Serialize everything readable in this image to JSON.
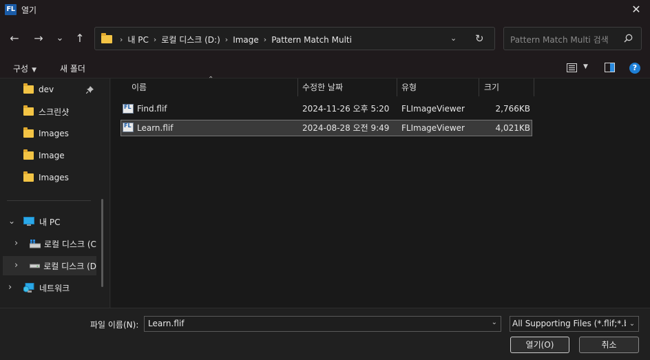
{
  "window": {
    "app_icon_text": "FL",
    "title": "열기",
    "close_glyph": "✕"
  },
  "nav": {
    "back": "←",
    "forward": "→",
    "recent": "⌄",
    "up": "↑",
    "breadcrumb": [
      "내 PC",
      "로컬 디스크 (D:)",
      "Image",
      "Pattern Match Multi"
    ],
    "first_sep": "›",
    "separators": [
      "›",
      "›",
      "›"
    ],
    "dropdown_glyph": "⌄",
    "refresh_glyph": "↻",
    "search_placeholder": "Pattern Match Multi 검색"
  },
  "toolbar": {
    "organize_label": "구성",
    "organize_caret": "▼",
    "new_folder_label": "새 폴더",
    "view_caret": "▼",
    "help_glyph": "?"
  },
  "sidebar": {
    "quick_access": [
      {
        "label": "dev",
        "pinned": true
      },
      {
        "label": "스크린샷"
      },
      {
        "label": "Images"
      },
      {
        "label": "Image"
      },
      {
        "label": "Images"
      }
    ],
    "this_pc": {
      "label": "내 PC",
      "chevron": "⌄"
    },
    "drives": [
      {
        "label": "로컬 디스크 (C",
        "chevron": "›"
      },
      {
        "label": "로컬 디스크 (D",
        "chevron": "›",
        "selected": true
      }
    ],
    "network": {
      "label": "네트워크",
      "chevron": "›"
    }
  },
  "filelist": {
    "columns": [
      "이름",
      "수정한 날짜",
      "유형",
      "크기"
    ],
    "sort_glyph": "⌃",
    "rows": [
      {
        "name": "Find.flif",
        "modified": "2024-11-26 오후 5:20",
        "type": "FLImageViewer",
        "size": "2,766KB"
      },
      {
        "name": "Learn.flif",
        "modified": "2024-08-28 오전 9:49",
        "type": "FLImageViewer",
        "size": "4,021KB",
        "selected": true
      }
    ]
  },
  "footer": {
    "filename_label": "파일 이름(N):",
    "filename_value": "Learn.flif",
    "filename_caret": "⌄",
    "filetype_value": "All Supporting Files (*.flif;*.bm",
    "filetype_caret": "⌄",
    "open_label": "열기(O)",
    "cancel_label": "취소"
  },
  "colors": {
    "accent": "#1e7fd6",
    "folder": "#f3c445",
    "background": "#202020",
    "titlebar": "#1f1a1c"
  }
}
